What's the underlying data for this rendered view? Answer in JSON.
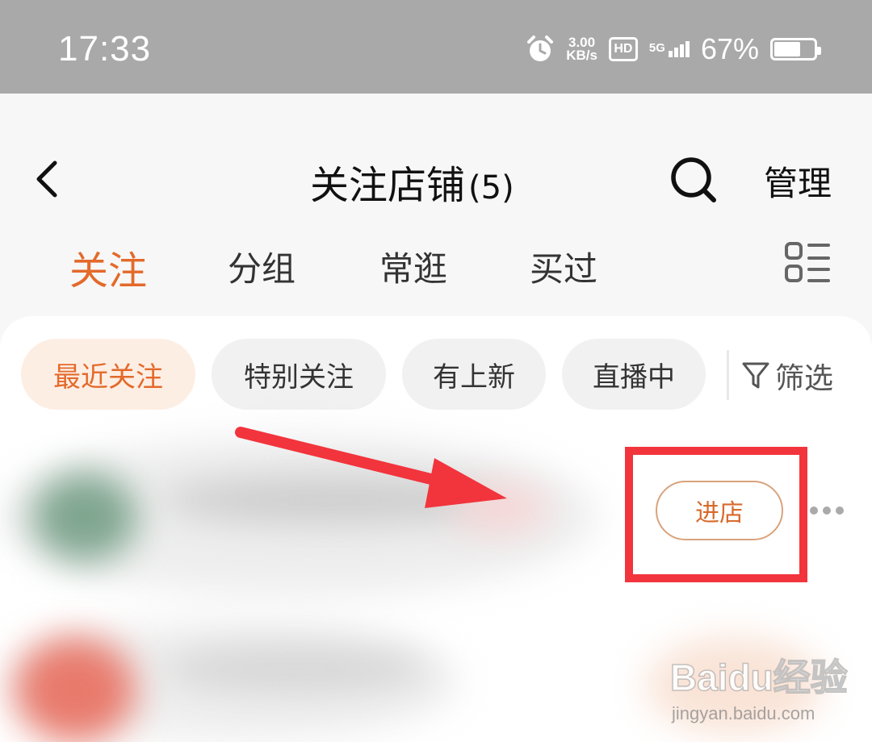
{
  "status_bar": {
    "time": "17:33",
    "net_speed_value": "3.00",
    "net_speed_unit": "KB/s",
    "hd_badge": "HD",
    "network_type": "5G",
    "battery_percent": "67%",
    "battery_level": 0.67,
    "icons": [
      "alarm-clock-icon",
      "hd-icon",
      "signal-icon",
      "battery-icon"
    ]
  },
  "header": {
    "title": "关注店铺",
    "count": "(5)",
    "manage_label": "管理",
    "icons": [
      "back-chevron-icon",
      "search-icon"
    ]
  },
  "tabs": [
    {
      "label": "关注",
      "active": true
    },
    {
      "label": "分组",
      "active": false
    },
    {
      "label": "常逛",
      "active": false
    },
    {
      "label": "买过",
      "active": false
    }
  ],
  "filter_chips": [
    {
      "label": "最近关注",
      "active": true
    },
    {
      "label": "特别关注",
      "active": false
    },
    {
      "label": "有上新",
      "active": false
    },
    {
      "label": "直播中",
      "active": false
    }
  ],
  "filter_label": "筛选",
  "shop_rows": [
    {
      "enter_label": "进店"
    }
  ],
  "watermark": {
    "logo": "Baidu经验",
    "url": "jingyan.baidu.com"
  },
  "colors": {
    "accent": "#e36a2b",
    "annotation_red": "#f2343c",
    "status_bar_bg": "#a9a9a9"
  }
}
